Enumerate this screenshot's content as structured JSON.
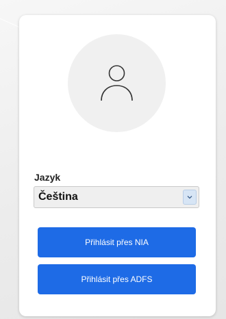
{
  "login": {
    "language_label": "Jazyk",
    "language_selected": "Čeština",
    "nia_button_label": "Přihlásit přes NIA",
    "adfs_button_label": "Přihlásit přes ADFS"
  },
  "icons": {
    "avatar": "user-icon",
    "select_arrow": "chevron-down-icon"
  },
  "colors": {
    "accent": "#1e6be6",
    "avatar_background": "#f0f0f0",
    "card_background": "#ffffff"
  }
}
